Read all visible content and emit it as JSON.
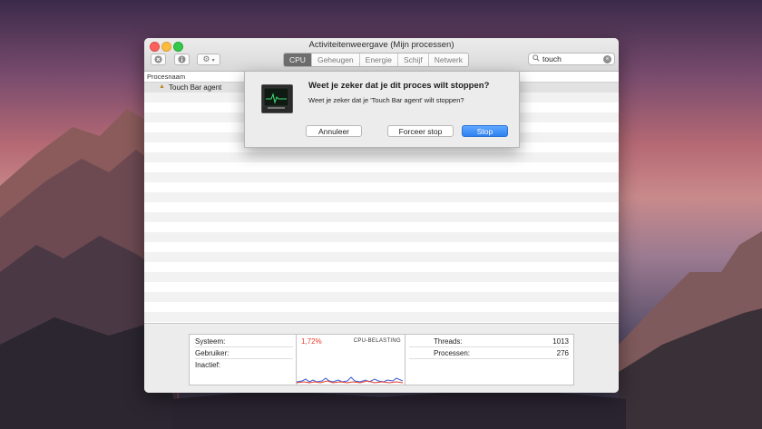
{
  "window": {
    "title": "Activiteitenweergave (Mijn processen)"
  },
  "toolbar": {
    "stop_icon": "x-circle-icon",
    "info_icon": "info-icon",
    "gear_icon": "gear-icon",
    "tabs": [
      "CPU",
      "Geheugen",
      "Energie",
      "Schijf",
      "Netwerk"
    ],
    "active_tab": "CPU",
    "search_value": "touch"
  },
  "table": {
    "column_header": "Procesnaam",
    "rows": [
      {
        "name": "Touch Bar agent"
      }
    ]
  },
  "stats": {
    "left": [
      {
        "label": "Systeem:"
      },
      {
        "label": "Gebruiker:"
      },
      {
        "label": "Inactief:"
      }
    ],
    "cpu_percent": "1,72%",
    "graph_label": "CPU-BELASTING",
    "right": [
      {
        "label": "Threads:",
        "value": "1013"
      },
      {
        "label": "Processen:",
        "value": "276"
      }
    ]
  },
  "dialog": {
    "title": "Weet je zeker dat je dit proces wilt stoppen?",
    "message": "Weet je zeker dat je 'Touch Bar agent' wilt stoppen?",
    "cancel_label": "Annuleer",
    "force_label": "Forceer stop",
    "stop_label": "Stop",
    "icon": "activity-monitor-icon"
  },
  "colors": {
    "accent": "#2f81f0",
    "cpu_red": "#e43b2b",
    "graph_blue": "#3a5bd6"
  }
}
